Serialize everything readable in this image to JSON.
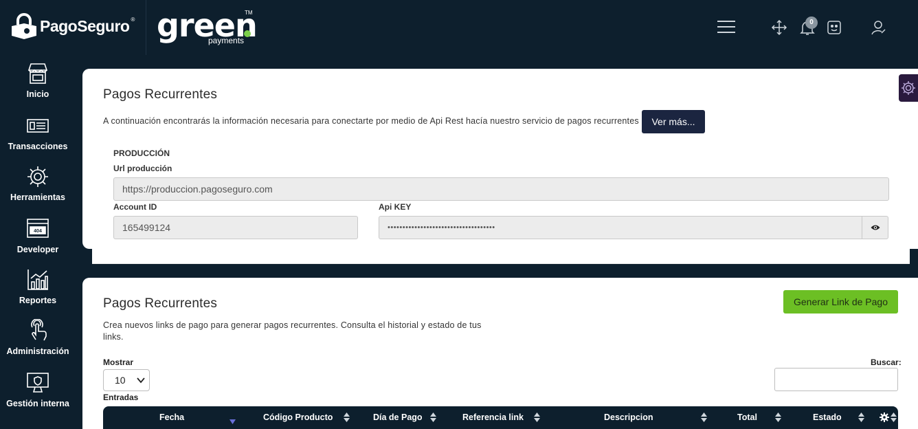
{
  "brand": {
    "pagoseguro": "PagoSeguro",
    "reg_mark": "®",
    "green_word": "gree",
    "green_n": "n",
    "green_tm": "TM",
    "green_sub": "payments"
  },
  "header": {
    "notifications_count": "0"
  },
  "sidebar": {
    "items": [
      {
        "label": "Inicio",
        "icon": "store-icon"
      },
      {
        "label": "Transacciones",
        "icon": "card-icon"
      },
      {
        "label": "Herramientas",
        "icon": "gear-icon"
      },
      {
        "label": "Developer",
        "icon": "browser-404-icon"
      },
      {
        "label": "Reportes",
        "icon": "bar-chart-icon"
      },
      {
        "label": "Administración",
        "icon": "hand-touch-icon"
      },
      {
        "label": "Gestión interna",
        "icon": "monitor-shield-icon"
      }
    ]
  },
  "api_card": {
    "title": "Pagos Recurrentes",
    "description": "A continuación encontrarás la información necesaria para conectarte por medio de Api Rest hacía nuestro servicio de pagos recurrentes",
    "more_button": "Ver más...",
    "section": "PRODUCCIÓN",
    "url_label": "Url producción",
    "url_value": "https://produccion.pagoseguro.com",
    "account_label": "Account ID",
    "account_value": "165499124",
    "apikey_label": "Api KEY",
    "apikey_value": "••••••••••••••••••••••••••••••••••••"
  },
  "links_card": {
    "title": "Pagos Recurrentes",
    "description": "Crea nuevos links de pago para generar pagos recurrentes. Consulta el historial y estado de tus links.",
    "generate_button": "Generar Link de Pago",
    "show_label": "Mostrar",
    "page_size": "10",
    "entries_label": "Entradas",
    "search_label": "Buscar:",
    "columns": [
      "Fecha",
      "Código Producto",
      "Día de Pago",
      "Referencia link",
      "Descripcion",
      "Total",
      "Estado"
    ]
  },
  "colors": {
    "navy": "#0d1f2d",
    "button_dark": "#1b2540",
    "button_green": "#6cbf24",
    "sort_active": "#6a6fd8"
  }
}
